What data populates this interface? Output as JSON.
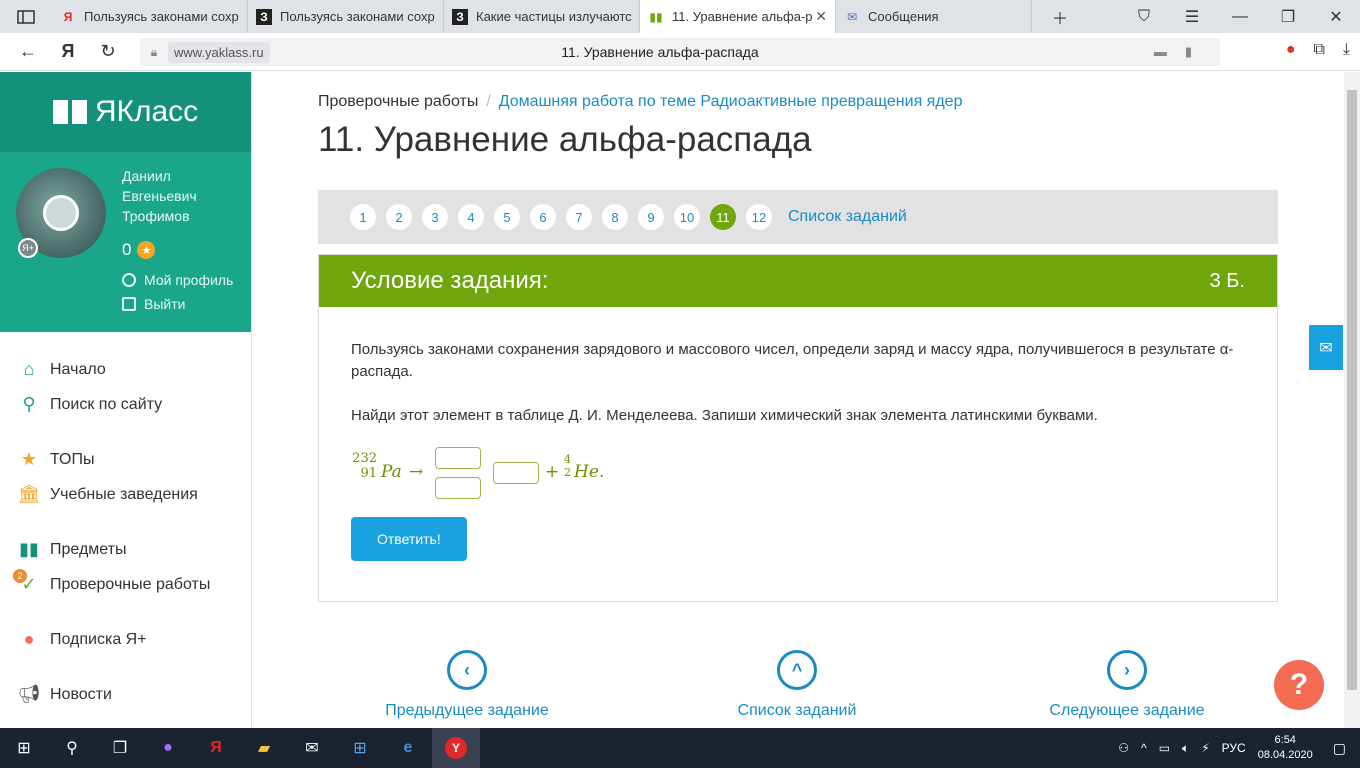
{
  "browser": {
    "tabs": [
      {
        "label": "Пользуясь законами сохр",
        "favicon": "Я",
        "fav_color": "#e02828"
      },
      {
        "label": "Пользуясь законами сохр",
        "favicon": "З",
        "fav_color": "#222222"
      },
      {
        "label": "Какие частицы излучаютс",
        "favicon": "З",
        "fav_color": "#222222"
      },
      {
        "label": "11. Уравнение альфа-р",
        "favicon": "▮▮",
        "fav_color": "#6fa60c",
        "active": true
      },
      {
        "label": "Сообщения",
        "favicon": "✉",
        "fav_color": "#4a76a8"
      }
    ],
    "host": "www.yaklass.ru",
    "page_title": "11. Уравнение альфа-распада"
  },
  "sidebar": {
    "brand": "ЯКласс",
    "user_first": "Даниил",
    "user_middle": "Евгеньевич",
    "user_last": "Трофимов",
    "points": "0",
    "profile_link": "Мой профиль",
    "logout_link": "Выйти",
    "menu": {
      "home": "Начало",
      "search": "Поиск по сайту",
      "tops": "ТОПы",
      "schools": "Учебные заведения",
      "subjects": "Предметы",
      "tests": "Проверочные работы",
      "tests_badge": "2",
      "subscription": "Подписка Я+",
      "news": "Новости"
    }
  },
  "main": {
    "crumb_root": "Проверочные работы",
    "crumb_link": "Домашняя работа по теме Радиоактивные превращения ядер",
    "title": "11. Уравнение альфа-распада",
    "pages": [
      "1",
      "2",
      "3",
      "4",
      "5",
      "6",
      "7",
      "8",
      "9",
      "10",
      "11",
      "12"
    ],
    "active_page": "11",
    "task_list_link": "Список заданий",
    "task_header": "Условие задания:",
    "task_points": "3 Б.",
    "paragraph1": "Пользуясь законами сохранения зарядового и массового чисел, определи заряд и массу ядра, получившегося в результате α-распада.",
    "paragraph2": "Найди этот элемент в таблице Д. И. Менделеева. Запиши химический знак элемента латинскими буквами.",
    "formula": {
      "mass": "232",
      "charge": "91",
      "element": "Pa",
      "arrow": "→",
      "plus": "+",
      "he_mass": "4",
      "he_charge": "2",
      "he": "He",
      "dot": "."
    },
    "submit": "Ответить!",
    "prev": "Предыдущее задание",
    "list": "Список заданий",
    "next": "Следующее задание"
  },
  "taskbar": {
    "lang": "РУС",
    "time": "6:54",
    "date": "08.04.2020"
  }
}
